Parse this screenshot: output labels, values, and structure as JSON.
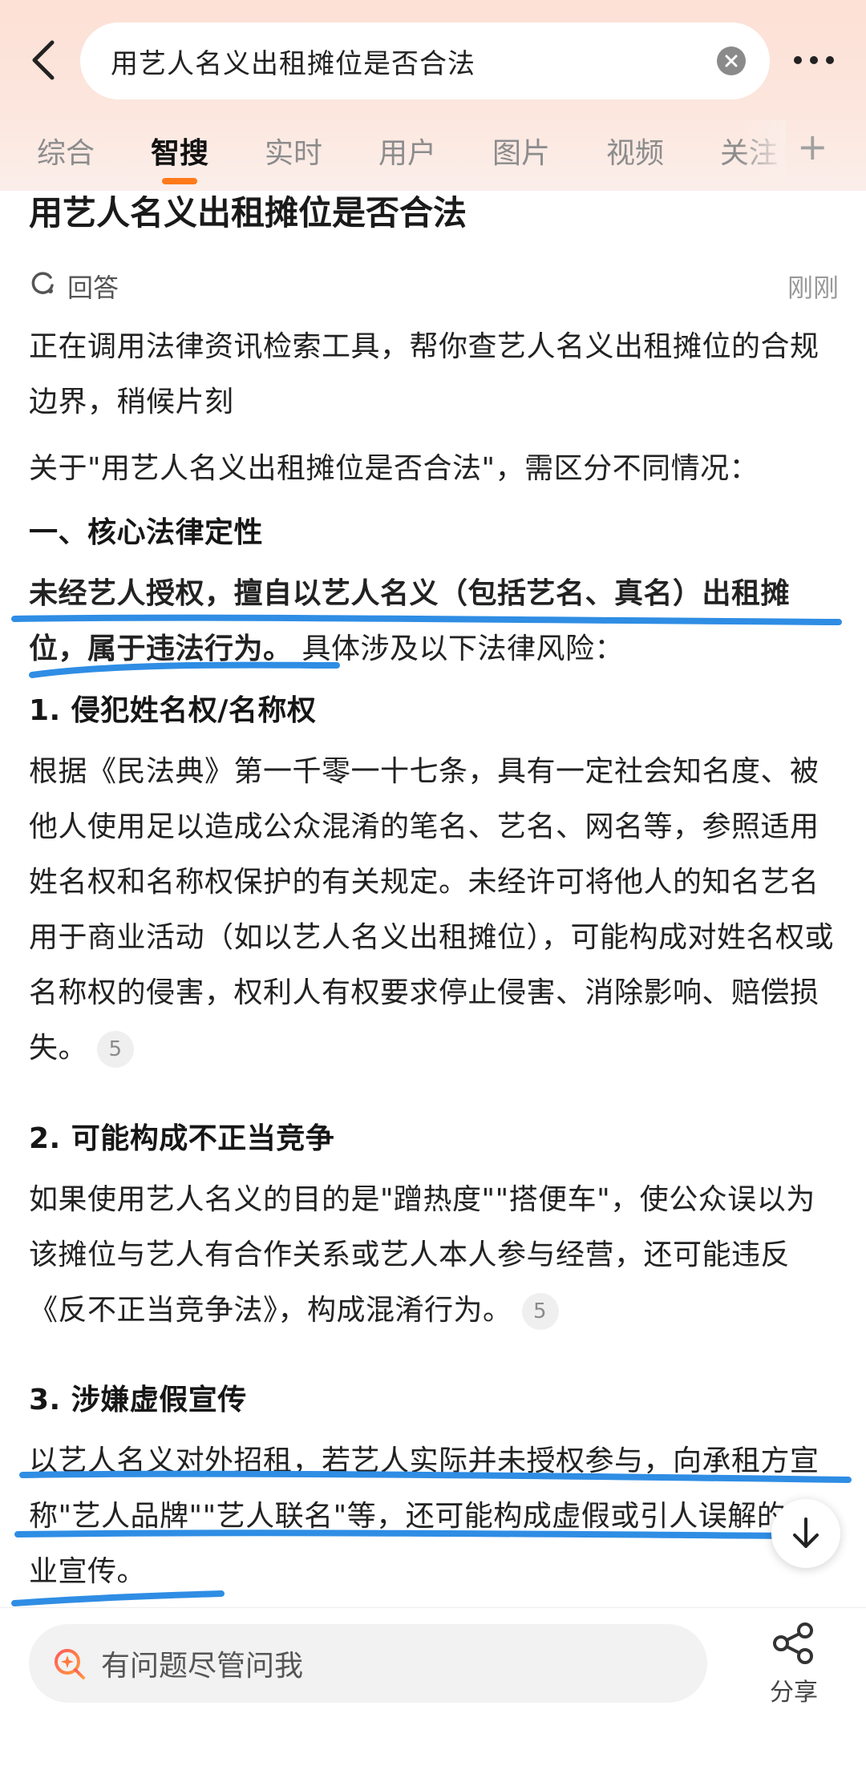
{
  "header": {
    "search_query": "用艺人名义出租摊位是否合法",
    "tabs": [
      "综合",
      "智搜",
      "实时",
      "用户",
      "图片",
      "视频",
      "关注"
    ],
    "active_tab": "智搜"
  },
  "answer": {
    "title": "用艺人名义出租摊位是否合法",
    "label": "回答",
    "time": "刚刚",
    "intro": "正在调用法律资讯检索工具，帮你查艺人名义出租摊位的合规边界，稍候片刻",
    "lead": "关于\"用艺人名义出租摊位是否合法\"，需区分不同情况：",
    "section1_heading": "一、核心法律定性",
    "section1_bold": "未经艺人授权，擅自以艺人名义（包括艺名、真名）出租摊位，属于违法行为。",
    "section1_rest": "具体涉及以下法律风险：",
    "point1_heading": "1. 侵犯姓名权/名称权",
    "point1_body": "根据《民法典》第一千零一十七条，具有一定社会知名度、被他人使用足以造成公众混淆的笔名、艺名、网名等，参照适用姓名权和名称权保护的有关规定。未经许可将他人的知名艺名用于商业活动（如以艺人名义出租摊位），可能构成对姓名权或名称权的侵害，权利人有权要求停止侵害、消除影响、赔偿损失。",
    "point1_cite": "5",
    "point2_heading": "2. 可能构成不正当竞争",
    "point2_body": "如果使用艺人名义的目的是\"蹭热度\"\"搭便车\"，使公众误以为该摊位与艺人有合作关系或艺人本人参与经营，还可能违反《反不正当竞争法》，构成混淆行为。",
    "point2_cite": "5",
    "point3_heading": "3. 涉嫌虚假宣传",
    "point3_body": "以艺人名义对外招租，若艺人实际并未授权参与，向承租方宣称\"艺人品牌\"\"艺人联名\"等，还可能构成虚假或引人误解的商业宣传。"
  },
  "bottom": {
    "ask_placeholder": "有问题尽管问我",
    "share_label": "分享"
  },
  "colors": {
    "accent": "#ff7a1a",
    "ink": "#2f8de4"
  }
}
